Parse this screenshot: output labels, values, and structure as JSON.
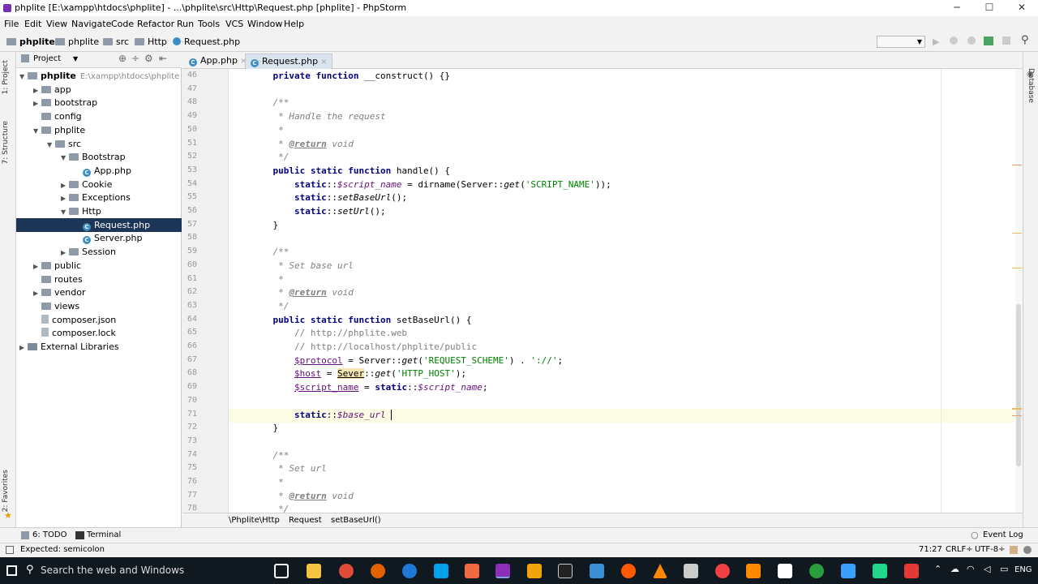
{
  "window": {
    "title": "phplite [E:\\xampp\\htdocs\\phplite] - ...\\phplite\\src\\Http\\Request.php [phplite] - PhpStorm",
    "minimize": "─",
    "maximize": "☐",
    "close": "✕"
  },
  "menu": [
    "File",
    "Edit",
    "View",
    "Navigate",
    "Code",
    "Refactor",
    "Run",
    "Tools",
    "VCS",
    "Window",
    "Help"
  ],
  "nav": {
    "crumbs": [
      "phplite",
      "phplite",
      "src",
      "Http",
      "Request.php"
    ]
  },
  "left_tools": {
    "project": "1: Project",
    "structure": "7: Structure",
    "favorites": "2: Favorites"
  },
  "project": {
    "header": "Project",
    "rows": [
      {
        "indent": 0,
        "arrow": "▼",
        "icon": "folder",
        "label": "phplite",
        "extra": "E:\\xampp\\htdocs\\phplite",
        "bold": true
      },
      {
        "indent": 1,
        "arrow": "▶",
        "icon": "folder",
        "label": "app"
      },
      {
        "indent": 1,
        "arrow": "▶",
        "icon": "folder",
        "label": "bootstrap"
      },
      {
        "indent": 1,
        "arrow": "",
        "icon": "folder",
        "label": "config"
      },
      {
        "indent": 1,
        "arrow": "▼",
        "icon": "folder",
        "label": "phplite"
      },
      {
        "indent": 2,
        "arrow": "▼",
        "icon": "folder",
        "label": "src"
      },
      {
        "indent": 3,
        "arrow": "▼",
        "icon": "folder",
        "label": "Bootstrap"
      },
      {
        "indent": 4,
        "arrow": "",
        "icon": "php",
        "label": "App.php"
      },
      {
        "indent": 3,
        "arrow": "▶",
        "icon": "folder",
        "label": "Cookie"
      },
      {
        "indent": 3,
        "arrow": "▶",
        "icon": "folder",
        "label": "Exceptions"
      },
      {
        "indent": 3,
        "arrow": "▼",
        "icon": "folder",
        "label": "Http"
      },
      {
        "indent": 4,
        "arrow": "",
        "icon": "php",
        "label": "Request.php",
        "selected": true
      },
      {
        "indent": 4,
        "arrow": "",
        "icon": "php",
        "label": "Server.php"
      },
      {
        "indent": 3,
        "arrow": "▶",
        "icon": "folder",
        "label": "Session"
      },
      {
        "indent": 1,
        "arrow": "▶",
        "icon": "folder",
        "label": "public"
      },
      {
        "indent": 1,
        "arrow": "",
        "icon": "folder",
        "label": "routes"
      },
      {
        "indent": 1,
        "arrow": "▶",
        "icon": "folder",
        "label": "vendor"
      },
      {
        "indent": 1,
        "arrow": "",
        "icon": "folder",
        "label": "views"
      },
      {
        "indent": 1,
        "arrow": "",
        "icon": "file",
        "label": "composer.json"
      },
      {
        "indent": 1,
        "arrow": "",
        "icon": "file",
        "label": "composer.lock"
      },
      {
        "indent": 0,
        "arrow": "▶",
        "icon": "lib",
        "label": "External Libraries"
      }
    ]
  },
  "tabs": [
    {
      "label": "App.php",
      "close": "✕"
    },
    {
      "label": "Request.php",
      "close": "✕",
      "active": true
    }
  ],
  "code_lines": [
    {
      "n": "46",
      "html": "    <span class='kw'>private function</span> __construct() {}"
    },
    {
      "n": "47",
      "html": ""
    },
    {
      "n": "48",
      "html": "    <span class='cm'>/**</span>"
    },
    {
      "n": "49",
      "html": "<span class='cm'>     * Handle the request</span>"
    },
    {
      "n": "50",
      "html": "<span class='cm'>     *</span>"
    },
    {
      "n": "51",
      "html": "<span class='cm'>     * </span><span class='tag'>@return</span><span class='cm'> void</span>"
    },
    {
      "n": "52",
      "html": "<span class='cm'>     */</span>"
    },
    {
      "n": "53",
      "html": "    <span class='kw'>public static function</span> handle() {"
    },
    {
      "n": "54",
      "html": "        <span class='kw'>static</span>::<span class='var'>$script_name</span> = dirname(Server::<span class='fn'>get</span>(<span class='str'>'SCRIPT_NAME'</span>));"
    },
    {
      "n": "55",
      "html": "        <span class='kw'>static</span>::<span class='fn'>setBaseUrl</span>();"
    },
    {
      "n": "56",
      "html": "        <span class='kw'>static</span>::<span class='fn'>setUrl</span>();"
    },
    {
      "n": "57",
      "html": "    }"
    },
    {
      "n": "58",
      "html": ""
    },
    {
      "n": "59",
      "html": "    <span class='cm'>/**</span>"
    },
    {
      "n": "60",
      "html": "<span class='cm'>     * Set base url</span>"
    },
    {
      "n": "61",
      "html": "<span class='cm'>     *</span>"
    },
    {
      "n": "62",
      "html": "<span class='cm'>     * </span><span class='tag'>@return</span><span class='cm'> void</span>"
    },
    {
      "n": "63",
      "html": "<span class='cm'>     */</span>"
    },
    {
      "n": "64",
      "html": "    <span class='kw'>public static function</span> setBaseUrl() {"
    },
    {
      "n": "65",
      "html": "        <span class='cm' style='font-style:normal'>// http://phplite.web</span>"
    },
    {
      "n": "66",
      "html": "        <span class='cm' style='font-style:normal'>// http://localhost/phplite/public</span>"
    },
    {
      "n": "67",
      "html": "        <span class='var' style='font-style:normal;text-decoration:underline'>$protocol</span> = Server::<span class='fn'>get</span>(<span class='str'>'REQUEST_SCHEME'</span>) . <span class='str'>'://'</span>;"
    },
    {
      "n": "68",
      "html": "        <span class='var' style='font-style:normal;text-decoration:underline'>$host</span> = <span style='background:#f5e6b3;text-decoration:underline'>Sever</span>::<span class='fn'>get</span>(<span class='str'>'HTTP_HOST'</span>);"
    },
    {
      "n": "69",
      "html": "        <span class='var' style='font-style:normal;text-decoration:underline'>$script_name</span> = <span class='kw'>static</span>::<span class='var'>$script_name</span>;"
    },
    {
      "n": "70",
      "html": ""
    },
    {
      "n": "71",
      "html": "        <span class='kw'>static</span>::<span class='var'>$base_url</span> <span style='border-left:1px solid #000'>&nbsp;</span>"
    },
    {
      "n": "72",
      "html": "    }"
    },
    {
      "n": "73",
      "html": ""
    },
    {
      "n": "74",
      "html": "    <span class='cm'>/**</span>"
    },
    {
      "n": "75",
      "html": "<span class='cm'>     * Set url</span>"
    },
    {
      "n": "76",
      "html": "<span class='cm'>     *</span>"
    },
    {
      "n": "77",
      "html": "<span class='cm'>     * </span><span class='tag'>@return</span><span class='cm'> void</span>"
    },
    {
      "n": "78",
      "html": "<span class='cm'>     */</span>"
    }
  ],
  "editor_crumbs": [
    "\\Phplite\\Http",
    "Request",
    "setBaseUrl()"
  ],
  "right_tools": {
    "database": "Database"
  },
  "bottom_tools": {
    "todo": "6: TODO",
    "terminal": "Terminal",
    "event_log": "Event Log"
  },
  "status": {
    "message": "Expected: semicolon",
    "position": "71:27",
    "line_sep": "CRLF÷",
    "encoding": "UTF-8÷"
  },
  "taskbar": {
    "search": "Search the web and Windows",
    "lang": "ENG"
  },
  "colors": {
    "accent": "#7b2fb5",
    "selection": "#1d3557"
  }
}
